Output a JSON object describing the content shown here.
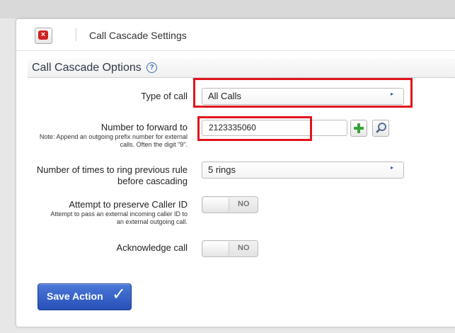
{
  "header": {
    "title": "Call Cascade Settings",
    "close_icon": "×"
  },
  "section": {
    "title": "Call Cascade Options",
    "help_icon": "?"
  },
  "fields": {
    "type_of_call": {
      "label": "Type of call",
      "value": "All Calls"
    },
    "number_to_forward": {
      "label": "Number to forward to",
      "note": "Note: Append an outgoing prefix number for external calls. Often the digit \"9\".",
      "value": "2123335060"
    },
    "ring_times": {
      "label": "Number of times to ring previous rule before cascading",
      "value": "5 rings"
    },
    "preserve_caller_id": {
      "label": "Attempt to preserve Caller ID",
      "note": "Attempt to pass an external incoming caller ID to an external outgoing call.",
      "state": "NO"
    },
    "acknowledge_call": {
      "label": "Acknowledge call",
      "state": "NO"
    }
  },
  "select_arrow": "▸",
  "save_button": {
    "label": "Save Action",
    "check": "✓"
  },
  "colors": {
    "highlight": "#e0141d",
    "button": "#2f5ac4",
    "plus": "#36a336"
  }
}
